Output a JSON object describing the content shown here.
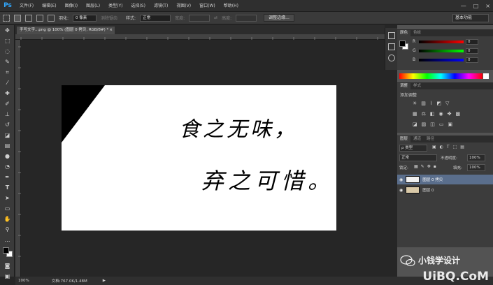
{
  "app": {
    "logo": "Ps",
    "menu": [
      "文件(F)",
      "编辑(E)",
      "图像(I)",
      "图层(L)",
      "类型(Y)",
      "选择(S)",
      "滤镜(T)",
      "视图(V)",
      "窗口(W)",
      "帮助(H)"
    ],
    "window_controls": [
      "—",
      "□",
      "×"
    ]
  },
  "options": {
    "feather_label": "羽化:",
    "feather_value": "0 像素",
    "antialias_label": "消除锯齿",
    "style_label": "样式:",
    "style_value": "正常",
    "width_label": "宽度:",
    "height_label": "高度:",
    "refine_edge_button": "调整边缘...",
    "workspace": "基本功能"
  },
  "document": {
    "tab_title": "手写文字...png @ 100% (图层 0 拷贝, RGB/8#) *",
    "zoom": "100%",
    "doc_info": "文档:767.0K/1.48M",
    "handwriting_line1": "食之无味，",
    "handwriting_line2": "弃之可惜。"
  },
  "panels": {
    "color_tabs": [
      "颜色",
      "色板"
    ],
    "color_channels": [
      {
        "label": "R",
        "value": "0"
      },
      {
        "label": "G",
        "value": "0"
      },
      {
        "label": "B",
        "value": "0"
      }
    ],
    "adjust_tabs": [
      "调整",
      "样式"
    ],
    "adjust_title": "添加调整",
    "layers_tabs": [
      "图层",
      "通道",
      "路径"
    ],
    "filter_kind": "ρ 类型",
    "blend_mode": "正常",
    "opacity_label": "不透明度:",
    "opacity_value": "100%",
    "lock_label": "锁定:",
    "fill_label": "填充:",
    "fill_value": "100%",
    "layers": [
      {
        "name": "图层 0 拷贝",
        "selected": true
      },
      {
        "name": "图层 0",
        "selected": false
      }
    ]
  },
  "watermark": {
    "line1": "小钱学设计",
    "line2": "UiBQ.CoM"
  },
  "colors": {
    "foreground": "#000000",
    "background": "#ffffff",
    "selection_fill": "#5a6e8c"
  }
}
